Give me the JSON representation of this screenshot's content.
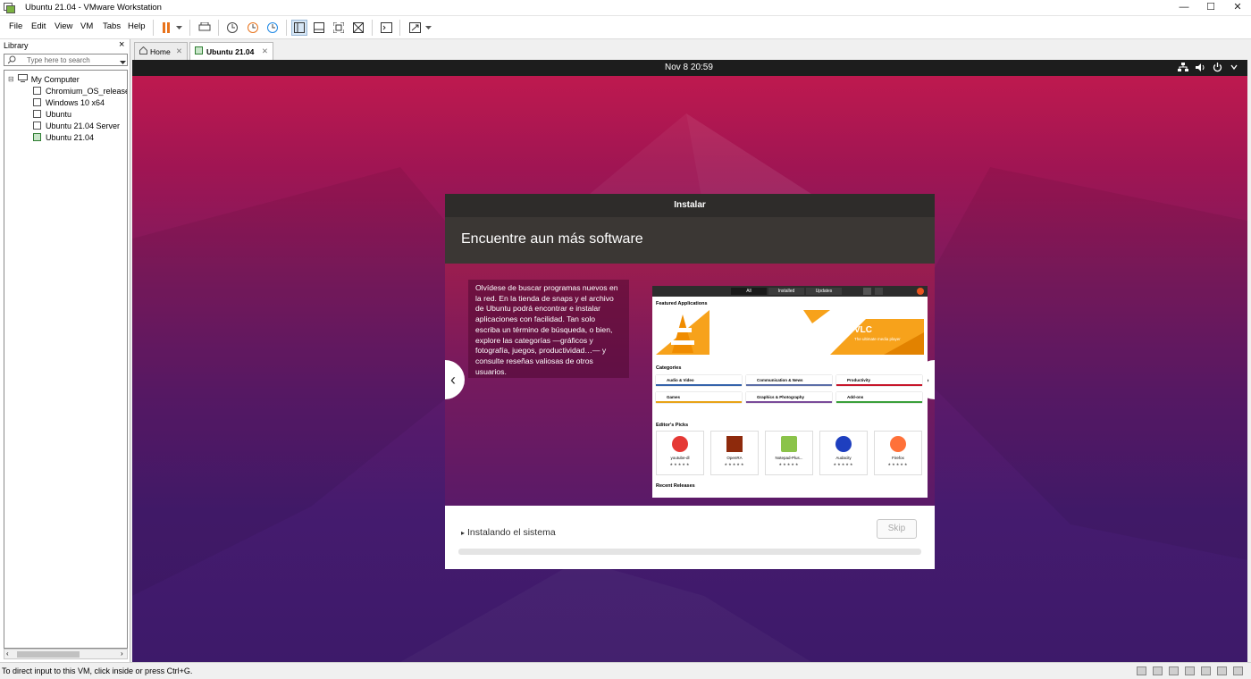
{
  "window": {
    "title": "Ubuntu 21.04 - VMware Workstation",
    "minimize": "—",
    "maximize": "☐",
    "close": "✕"
  },
  "menu": [
    "File",
    "Edit",
    "View",
    "VM",
    "Tabs",
    "Help"
  ],
  "library": {
    "title": "Library",
    "close": "×",
    "search_placeholder": "Type here to search",
    "root": "My Computer",
    "vms": [
      "Chromium_OS_release-l",
      "Windows 10 x64",
      "Ubuntu",
      "Ubuntu 21.04 Server",
      "Ubuntu 21.04"
    ]
  },
  "tabs": [
    {
      "label": "Home",
      "active": false
    },
    {
      "label": "Ubuntu 21.04",
      "active": true
    }
  ],
  "gnome": {
    "clock": "Nov 8  20:59"
  },
  "installer": {
    "header": "Instalar",
    "hero_title": "Encuentre aun más software",
    "slide_text": "Olvídese de buscar programas nuevos en la red. En la tienda de snaps y el archivo de Ubuntu podrá encontrar e instalar aplicaciones con facilidad. Tan solo escriba un término de búsqueda, o bien, explore las categorías —gráficos y fotografía, juegos, productividad…— y consulte reseñas valiosas de otros usuarios.",
    "prev": "‹",
    "next": "›",
    "progress_label": "Instalando el sistema",
    "skip": "Skip",
    "progress": 0.0
  },
  "software": {
    "tabs": [
      "All",
      "Installed",
      "Updates"
    ],
    "featured_heading": "Featured Applications",
    "vlc_title": "VLC",
    "vlc_subtitle": "The ultimate media player",
    "categories_heading": "Categories",
    "categories": [
      "Audio & Video",
      "Communication & News",
      "Productivity",
      "Games",
      "Graphics & Photography",
      "Add-ons"
    ],
    "editors_heading": "Editor's Picks",
    "picks": [
      "youtube-dl",
      "OpenRA",
      "Notepad-Plus...",
      "Audacity",
      "Firefox"
    ],
    "stars": "★★★★★",
    "recent_heading": "Recent Releases"
  },
  "statusbar": {
    "text": "To direct input to this VM, click inside or press Ctrl+G."
  },
  "colors": {
    "accent": "#e95420",
    "panel": "#1d1d1d",
    "installer_header": "#2e2c2a"
  }
}
